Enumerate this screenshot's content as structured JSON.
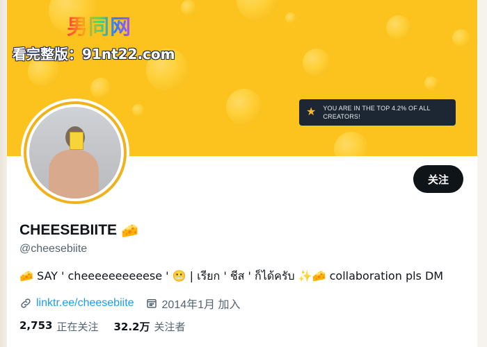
{
  "watermark": {
    "logo": "男同网",
    "text": "看完整版：91nt22.com"
  },
  "banner": {
    "badge_icon": "star-icon",
    "badge_line1": "YOU ARE IN THE TOP 4.2% OF ALL",
    "badge_line2": "CREATORS!",
    "colors": {
      "background": "#fcc31f",
      "badge": "#1d2733",
      "star": "#f7b928"
    }
  },
  "profile": {
    "follow_label": "关注",
    "display_name": "CHEESEBIITE",
    "name_emoji": "🧀",
    "handle": "@cheesebiite",
    "bio": "🧀 SAY ' cheeeeeeeeeese ' 😬 | เรียก ' ชีส ' ก็ได้ครับ ✨🧀 collaboration pls DM",
    "link_icon": "link-icon",
    "link_text": "linktr.ee/cheesebiite",
    "calendar_icon": "calendar-icon",
    "joined": "2014年1月 加入"
  },
  "stats": {
    "following_count": "2,753",
    "following_label": "正在关注",
    "followers_count": "32.2万",
    "followers_label": "关注者"
  }
}
